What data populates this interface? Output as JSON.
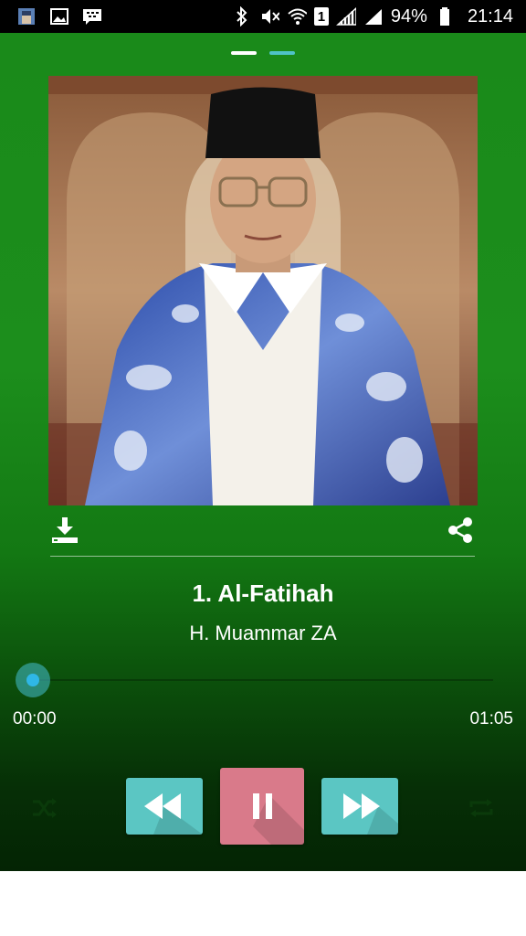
{
  "status_bar": {
    "battery": "94%",
    "time": "21:14",
    "sim_label": "1",
    "icons": [
      "gallery-app-icon",
      "image-icon",
      "bbm-icon",
      "bluetooth-icon",
      "mute-icon",
      "wifi-icon",
      "sim-icon",
      "signal-icon",
      "signal-icon-2",
      "battery-icon"
    ]
  },
  "pager": {
    "pages": 2,
    "active_page": 1,
    "colors": {
      "active": "#ffffff",
      "inactive": "#4fc3c7"
    }
  },
  "artwork": {
    "description_icon": "album-art-portrait"
  },
  "actions": {
    "download_icon": "download-icon",
    "share_icon": "share-icon"
  },
  "track": {
    "title": "1. Al-Fatihah",
    "artist": "H. Muammar ZA"
  },
  "progress": {
    "elapsed": "00:00",
    "duration": "01:05",
    "position_fraction": 0
  },
  "controls": {
    "shuffle_icon": "shuffle-icon",
    "rewind_icon": "rewind-icon",
    "pause_icon": "pause-icon",
    "forward_icon": "fast-forward-icon",
    "repeat_icon": "repeat-icon"
  },
  "colors": {
    "background_top": "#1a8a1a",
    "background_bottom": "#042404",
    "accent_teal": "#5bc6c3",
    "accent_pink": "#d97a8a",
    "seek_thumb": "#2fb7e6"
  }
}
